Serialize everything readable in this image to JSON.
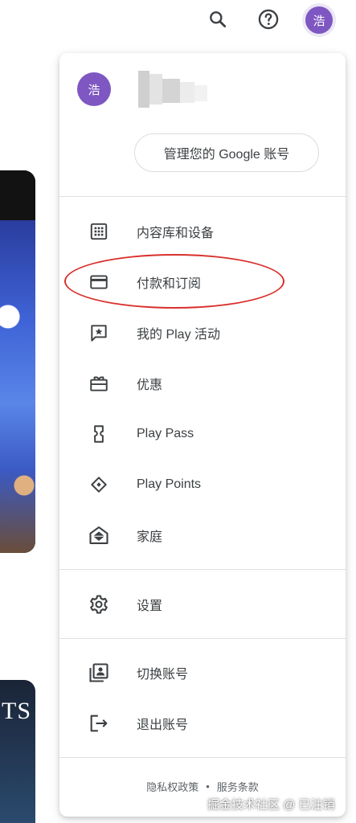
{
  "topbar": {
    "search_icon": "search-icon",
    "help_icon": "help-icon",
    "avatar_letter": "浩"
  },
  "profile": {
    "avatar_letter": "浩",
    "manage_account_label": "管理您的 Google 账号"
  },
  "menu": {
    "items": [
      {
        "label": "内容库和设备",
        "icon": "grid-icon"
      },
      {
        "label": "付款和订阅",
        "icon": "credit-card-icon"
      },
      {
        "label": "我的 Play 活动",
        "icon": "star-feedback-icon"
      },
      {
        "label": "优惠",
        "icon": "offers-gift-icon"
      },
      {
        "label": "Play Pass",
        "icon": "ticket-icon"
      },
      {
        "label": "Play Points",
        "icon": "diamond-icon"
      },
      {
        "label": "家庭",
        "icon": "family-home-icon"
      },
      {
        "label": "设置",
        "icon": "gear-icon"
      },
      {
        "label": "切换账号",
        "icon": "switch-account-icon"
      },
      {
        "label": "退出账号",
        "icon": "logout-icon"
      }
    ]
  },
  "footer": {
    "privacy": "隐私权政策",
    "separator": "•",
    "terms": "服务条款"
  },
  "background": {
    "card2_text": "TS"
  },
  "watermark": "掘金技术社区 @ 已注销",
  "colors": {
    "avatar": "#7e57c2",
    "annotation": "#d9302c",
    "icon": "#3c4043"
  }
}
